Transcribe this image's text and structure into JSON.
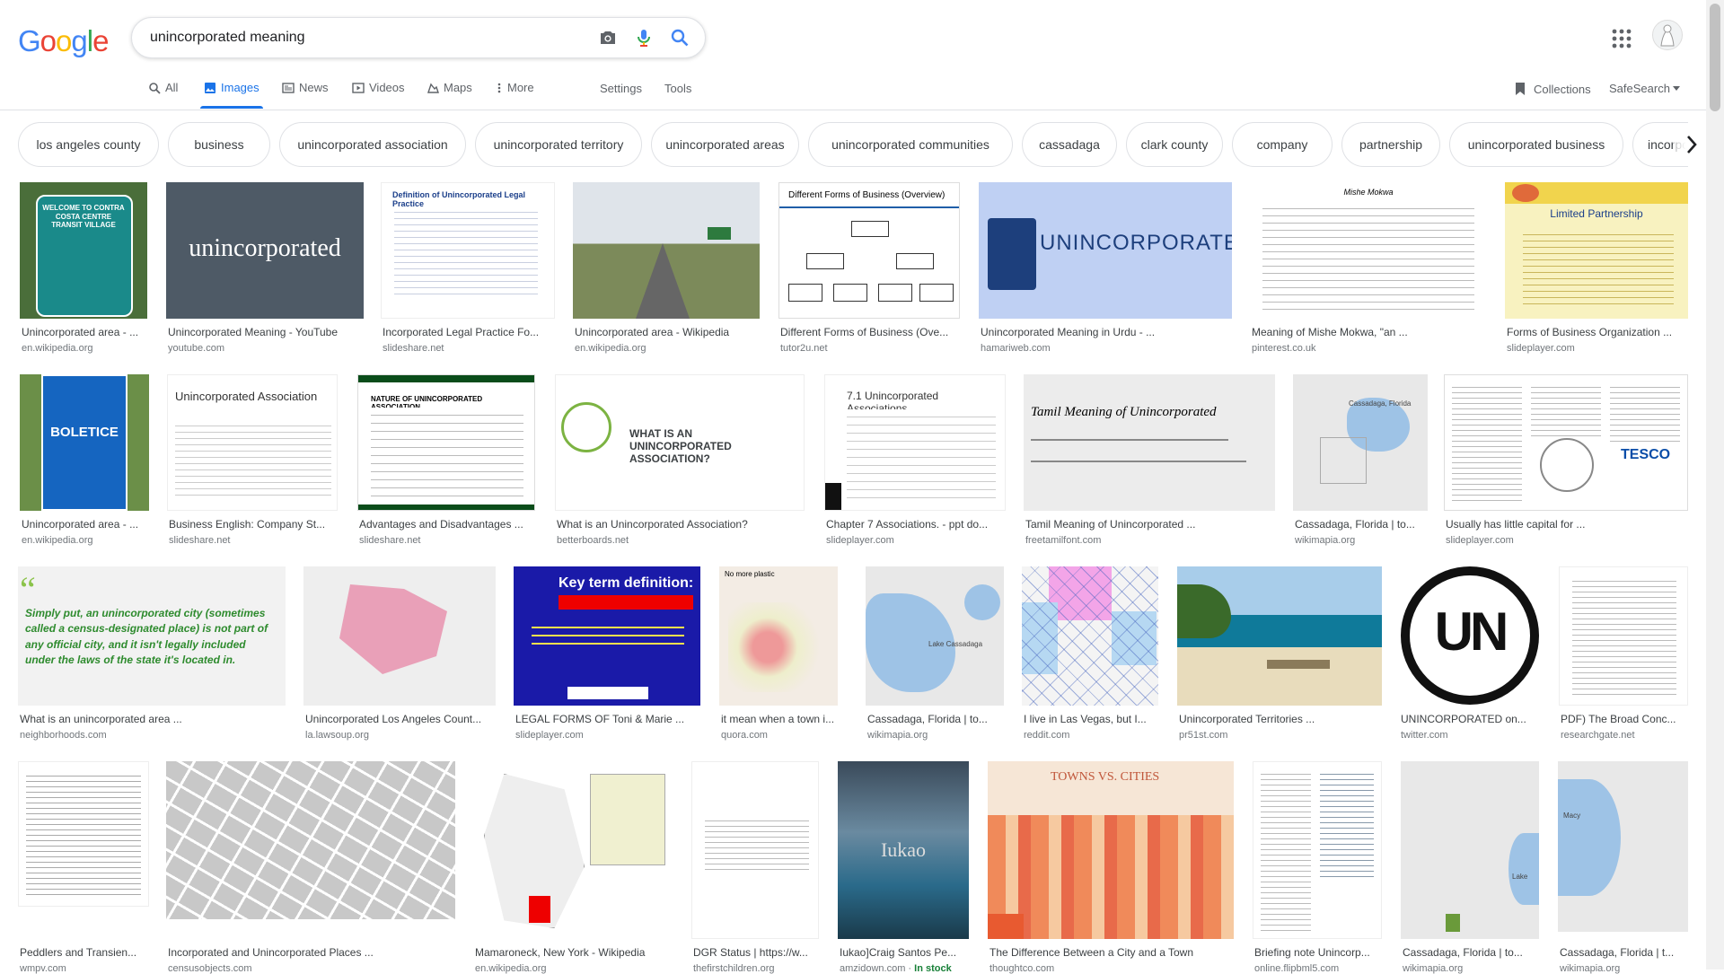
{
  "logo": "Google",
  "search": {
    "query": "unincorporated meaning"
  },
  "tabs": [
    {
      "label": "All",
      "icon": "search-icon"
    },
    {
      "label": "Images",
      "icon": "image-icon"
    },
    {
      "label": "News",
      "icon": "news-icon"
    },
    {
      "label": "Videos",
      "icon": "video-icon"
    },
    {
      "label": "Maps",
      "icon": "map-icon"
    },
    {
      "label": "More",
      "icon": "more-vert-icon"
    }
  ],
  "tools": {
    "settings": "Settings",
    "tools": "Tools"
  },
  "right": {
    "collections": "Collections",
    "safesearch": "SafeSearch"
  },
  "chips": [
    "los angeles county",
    "business",
    "unincorporated association",
    "unincorporated territory",
    "unincorporated areas",
    "unincorporated communities",
    "cassadaga",
    "clark county",
    "company",
    "partnership",
    "unincorporated business",
    "incorpora"
  ],
  "results": [
    {
      "caption": "Unincorporated area - ...",
      "source": "en.wikipedia.org",
      "thumb_text": "WELCOME TO CONTRA COSTA CENTRE TRANSIT VILLAGE"
    },
    {
      "caption": "Unincorporated Meaning - YouTube",
      "source": "youtube.com",
      "thumb_text": "unincorporated"
    },
    {
      "caption": "Incorporated Legal Practice Fo...",
      "source": "slideshare.net",
      "thumb_text": "Definition of Unincorporated Legal Practice"
    },
    {
      "caption": "Unincorporated area - Wikipedia",
      "source": "en.wikipedia.org",
      "thumb_text": ""
    },
    {
      "caption": "Different Forms of Business (Ove...",
      "source": "tutor2u.net",
      "thumb_text": "Different Forms of Business (Overview)"
    },
    {
      "caption": "Unincorporated Meaning in Urdu - ...",
      "source": "hamariweb.com",
      "thumb_text": "UNINCORPORATED"
    },
    {
      "caption": "Meaning of Mishe Mokwa, \"an ...",
      "source": "pinterest.co.uk",
      "thumb_text": "Mishe Mokwa"
    },
    {
      "caption": "Forms of Business Organization ...",
      "source": "slideplayer.com",
      "thumb_text": "Limited Partnership"
    },
    {
      "caption": "Unincorporated area - ...",
      "source": "en.wikipedia.org",
      "thumb_text": "BOLETICE"
    },
    {
      "caption": "Business English: Company St...",
      "source": "slideshare.net",
      "thumb_text": "Unincorporated Association"
    },
    {
      "caption": "Advantages and Disadvantages ...",
      "source": "slideshare.net",
      "thumb_text": "NATURE OF UNINCORPORATED ASSOCIATION"
    },
    {
      "caption": "What is an Unincorporated Association?",
      "source": "betterboards.net",
      "thumb_text": "WHAT IS AN UNINCORPORATED ASSOCIATION?"
    },
    {
      "caption": "Chapter 7 Associations. - ppt do...",
      "source": "slideplayer.com",
      "thumb_text": "7.1 Unincorporated Associations"
    },
    {
      "caption": "Tamil Meaning of Unincorporated ...",
      "source": "freetamilfont.com",
      "thumb_text": "Tamil Meaning of Unincorporated"
    },
    {
      "caption": "Cassadaga, Florida | to...",
      "source": "wikimapia.org",
      "thumb_text": "Cassadaga, Florida"
    },
    {
      "caption": "Usually has little capital for ...",
      "source": "slideplayer.com",
      "thumb_text": "TESCO"
    },
    {
      "caption": "What is an unincorporated area ...",
      "source": "neighborhoods.com",
      "thumb_text": "Simply put, an unincorporated city (sometimes called a census-designated place) is not part of any official city, and it isn't legally included under the laws of the state it's located in."
    },
    {
      "caption": "Unincorporated Los Angeles Count...",
      "source": "la.lawsoup.org",
      "thumb_text": ""
    },
    {
      "caption": "LEGAL FORMS OF Toni & Marie ...",
      "source": "slideplayer.com",
      "thumb_text": "Key term definition:"
    },
    {
      "caption": "it mean when a town i...",
      "source": "quora.com",
      "thumb_text": "No more plastic"
    },
    {
      "caption": "Cassadaga, Florida | to...",
      "source": "wikimapia.org",
      "thumb_text": "Lake Cassadaga"
    },
    {
      "caption": "I live in Las Vegas, but I...",
      "source": "reddit.com",
      "thumb_text": ""
    },
    {
      "caption": "Unincorporated Territories ...",
      "source": "pr51st.com",
      "thumb_text": ""
    },
    {
      "caption": "UNINCORPORATED on...",
      "source": "twitter.com",
      "thumb_text": "UN"
    },
    {
      "caption": "PDF) The Broad Conc...",
      "source": "researchgate.net",
      "thumb_text": ""
    },
    {
      "caption": "Peddlers and Transien...",
      "source": "wmpv.com",
      "thumb_text": ""
    },
    {
      "caption": "Incorporated and Unincorporated Places ...",
      "source": "censusobjects.com",
      "thumb_text": ""
    },
    {
      "caption": "Mamaroneck, New York - Wikipedia",
      "source": "en.wikipedia.org",
      "thumb_text": ""
    },
    {
      "caption": "DGR Status | https://w...",
      "source": "thefirstchildren.org",
      "thumb_text": ""
    },
    {
      "caption": "Iukao]Craig Santos Pe...",
      "source": "amzidown.com",
      "thumb_text": "Iukao",
      "stock": "In stock"
    },
    {
      "caption": "The Difference Between a City and a Town",
      "source": "thoughtco.com",
      "thumb_text": "TOWNS VS. CITIES"
    },
    {
      "caption": "Briefing note Unincorp...",
      "source": "online.flipbml5.com",
      "thumb_text": ""
    },
    {
      "caption": "Cassadaga, Florida | to...",
      "source": "wikimapia.org",
      "thumb_text": "Lake"
    },
    {
      "caption": "Cassadaga, Florida | t...",
      "source": "wikimapia.org",
      "thumb_text": "Macy"
    }
  ],
  "colors": {
    "link_blue": "#1a73e8",
    "caption": "#3c4043",
    "source": "#70757a",
    "border": "#dfe1e5"
  }
}
